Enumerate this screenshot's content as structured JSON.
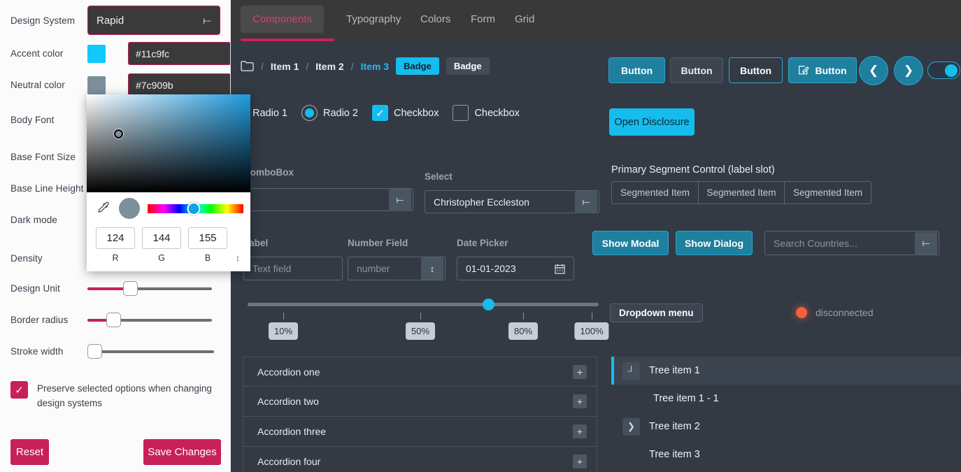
{
  "sidebar": {
    "rows": [
      {
        "label": "Design System"
      },
      {
        "label": "Accent color"
      },
      {
        "label": "Neutral color"
      },
      {
        "label": "Body Font"
      },
      {
        "label": "Base Font Size"
      },
      {
        "label": "Base Line Height"
      },
      {
        "label": "Dark mode"
      },
      {
        "label": "Density"
      },
      {
        "label": "Design Unit"
      },
      {
        "label": "Border radius"
      },
      {
        "label": "Stroke width"
      }
    ],
    "design_system_value": "Rapid",
    "accent_color_hex": "#11c9fc",
    "neutral_color_hex": "#7c909b",
    "preserve_label": "Preserve selected options when changing design systems",
    "reset_label": "Reset",
    "save_label": "Save Changes"
  },
  "color_picker": {
    "r": "124",
    "g": "144",
    "b": "155",
    "r_label": "R",
    "g_label": "G",
    "b_label": "B",
    "preview_hex": "#7c909b"
  },
  "tabs": [
    {
      "label": "Components",
      "active": true
    },
    {
      "label": "Typography",
      "active": false
    },
    {
      "label": "Colors",
      "active": false
    },
    {
      "label": "Form",
      "active": false
    },
    {
      "label": "Grid",
      "active": false
    }
  ],
  "breadcrumb": {
    "items": [
      "Item 1",
      "Item 2",
      "Item 3"
    ],
    "separator": "/",
    "badge_accent": "Badge",
    "badge_neutral": "Badge"
  },
  "top_buttons": {
    "b1": "Button",
    "b2": "Button",
    "b3": "Button",
    "b4": "Button",
    "disclosure": "Open Disclosure"
  },
  "controls": {
    "radio1": "Radio 1",
    "radio2": "Radio 2",
    "checkbox1": "Checkbox",
    "checkbox2": "Checkbox"
  },
  "fields": {
    "combobox_label": "ComboBox",
    "select_label": "Select",
    "select_value": "Christopher Eccleston",
    "textfield_label": "Label",
    "textfield_placeholder": "Text field",
    "number_label": "Number Field",
    "number_placeholder": "number",
    "date_label": "Date Picker",
    "date_value": "01-01-2023",
    "search_placeholder": "Search Countries..."
  },
  "segment": {
    "title": "Primary Segment Control (label slot)",
    "items": [
      "Segmented Item",
      "Segmented Item",
      "Segmented Item"
    ]
  },
  "dialogs": {
    "show_modal": "Show Modal",
    "show_dialog": "Show Dialog"
  },
  "percent_slider": {
    "marks": [
      "10%",
      "50%",
      "80%",
      "100%"
    ],
    "value": 67
  },
  "dropdown_menu_label": "Dropdown menu",
  "status": {
    "text": "disconnected",
    "color": "#f4603c"
  },
  "accordion": [
    "Accordion one",
    "Accordion two",
    "Accordion three",
    "Accordion four"
  ],
  "tree": [
    {
      "label": "Tree item 1",
      "indent": 0,
      "twisty": "collapse",
      "selected": true
    },
    {
      "label": "Tree item 1 - 1",
      "indent": 1,
      "twisty": "none",
      "selected": false
    },
    {
      "label": "Tree item 2",
      "indent": 0,
      "twisty": "expand",
      "selected": false
    },
    {
      "label": "Tree item 3",
      "indent": 0,
      "twisty": "none",
      "selected": false
    }
  ],
  "icons": {
    "folder": "folder-icon",
    "calendar": "calendar-icon",
    "eyedropper": "eyedropper-icon",
    "edit": "edit-icon"
  }
}
